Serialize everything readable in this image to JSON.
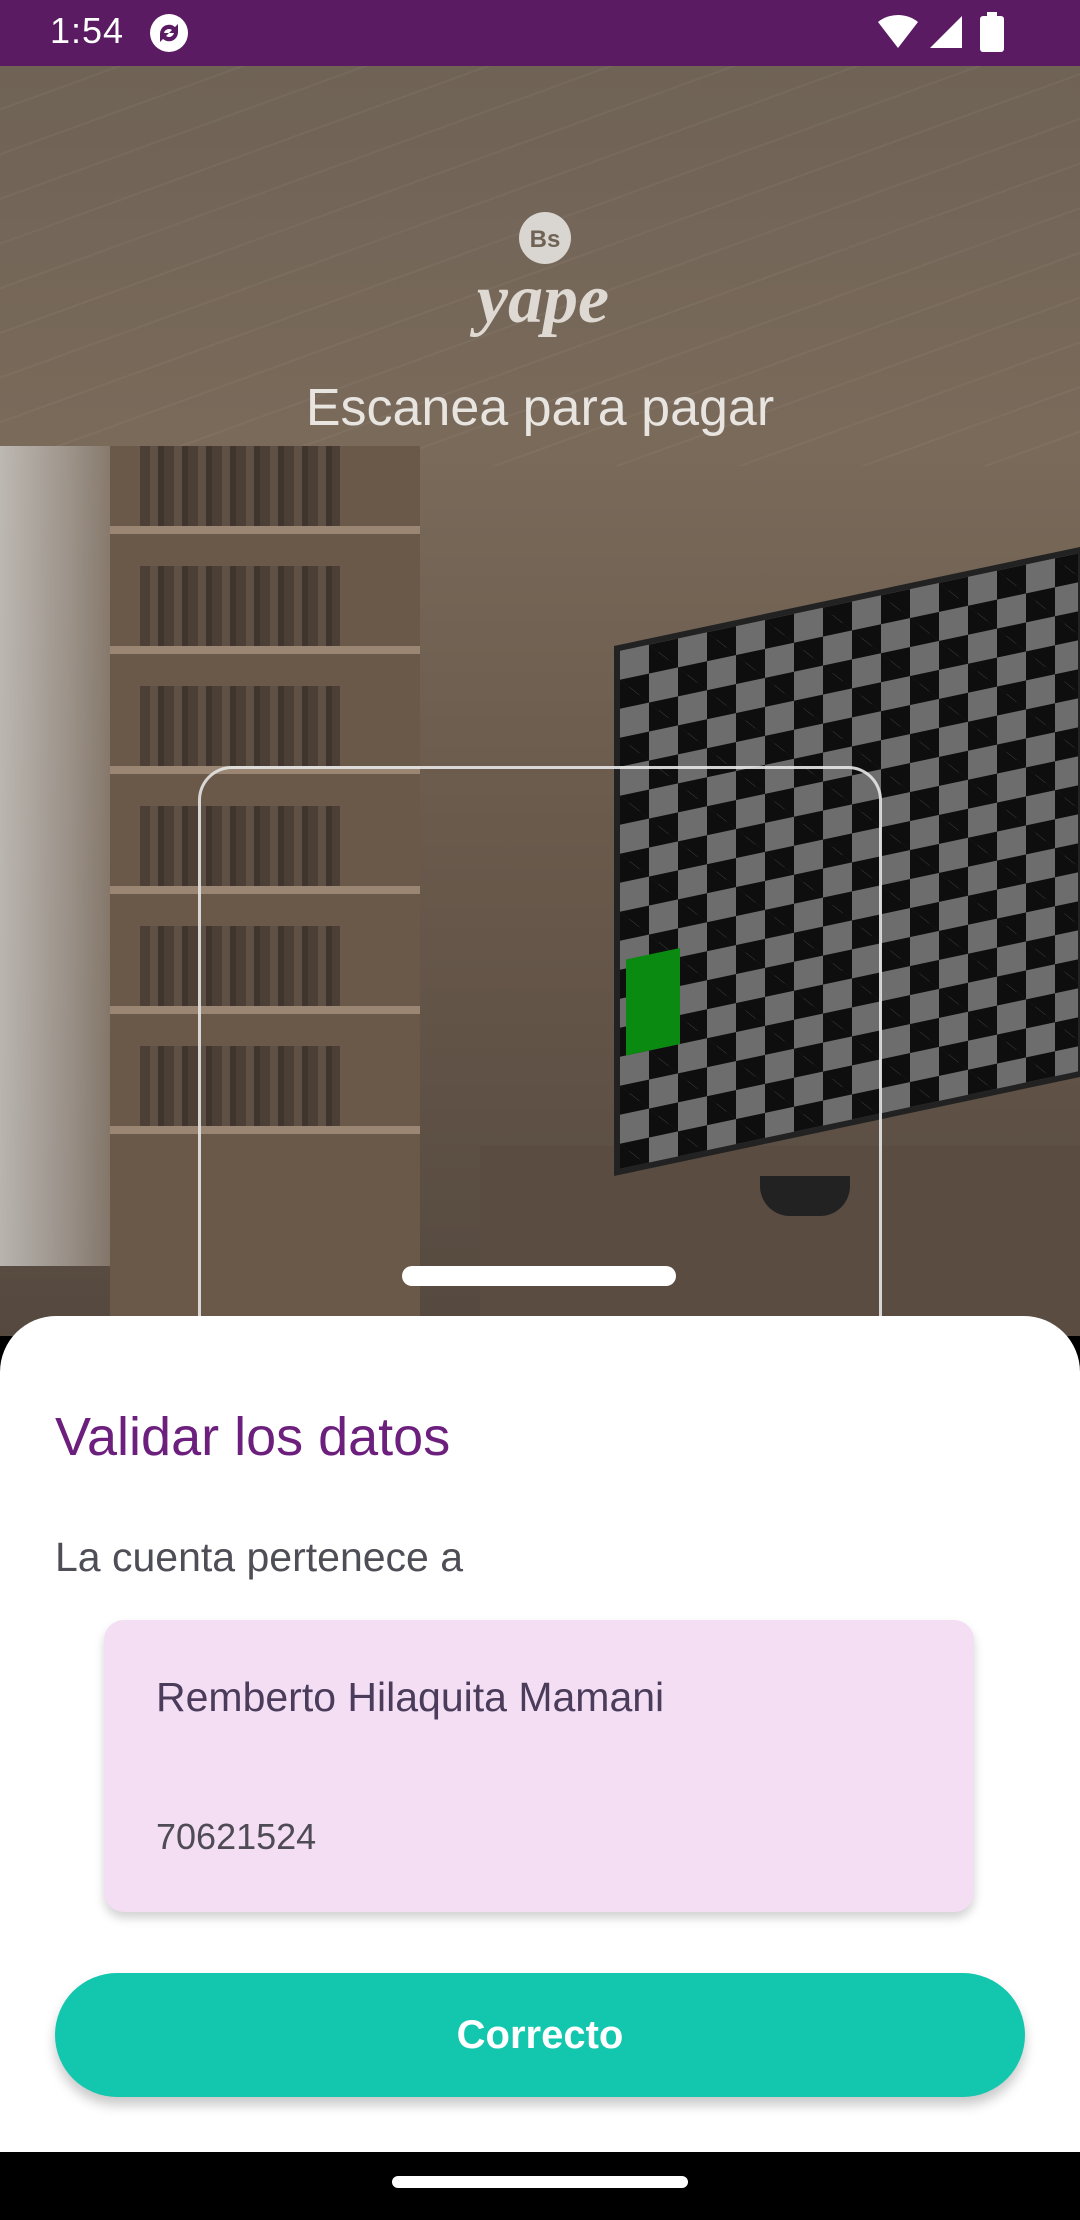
{
  "status_bar": {
    "time": "1:54",
    "icons": [
      "sync-icon",
      "wifi-icon",
      "signal-icon",
      "battery-icon"
    ]
  },
  "scanner": {
    "logo_badge": "Bs",
    "logo_text": "yape",
    "title": "Escanea para pagar"
  },
  "sheet": {
    "title": "Validar los datos",
    "subtitle": "La cuenta pertenece a",
    "account": {
      "name": "Remberto Hilaquita Mamani",
      "number": "70621524"
    },
    "confirm_label": "Correcto"
  },
  "colors": {
    "status_bar": "#5a1b63",
    "title": "#6c1f7d",
    "card": "#f4def4",
    "button": "#12c7ae"
  }
}
